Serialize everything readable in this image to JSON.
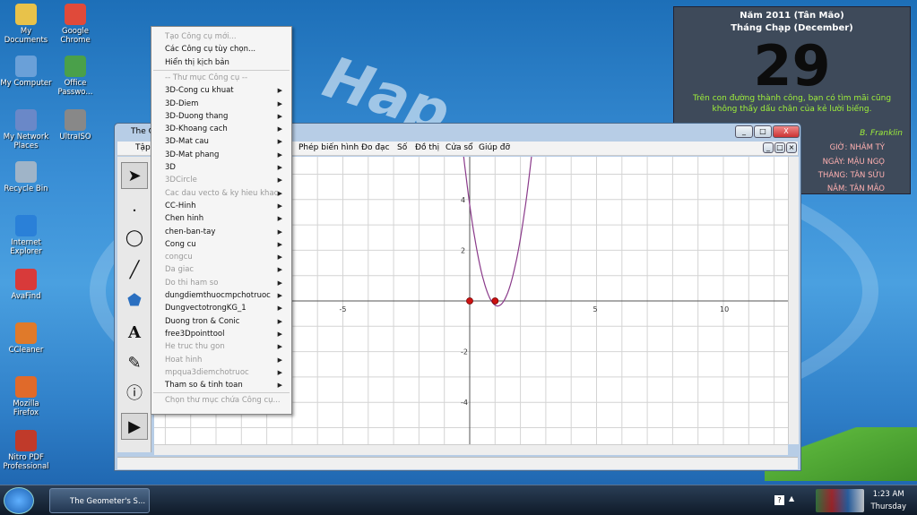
{
  "desktop": {
    "icons": [
      {
        "label": "My Documents"
      },
      {
        "label": "Google Chrome"
      },
      {
        "label": "My Computer"
      },
      {
        "label": "Office Passwo..."
      },
      {
        "label": "My Network Places"
      },
      {
        "label": "UltraISO"
      },
      {
        "label": "Recycle Bin"
      },
      {
        "label": "Internet Explorer"
      },
      {
        "label": "AvaFind"
      },
      {
        "label": "CCleaner"
      },
      {
        "label": "Mozilla Firefox"
      },
      {
        "label": "Nitro PDF Professional"
      }
    ]
  },
  "calendar": {
    "year_line": "Năm 2011 (Tân Mão)",
    "month_line": "Tháng Chạp (December)",
    "day": "29",
    "quote": "Trên con đường thành công, bạn có tìm mãi cũng không thấy dấu chân của kẻ lười biếng.",
    "author": "B. Franklin",
    "lunar": [
      "GIỜ: NHÂM TÝ",
      "NGÀY: MẬU NGỌ",
      "THÁNG: TÂN SỬU",
      "NĂM: TÂN MÃO"
    ]
  },
  "window": {
    "title": "The G",
    "menu": [
      "Tập",
      "Phép biến hình",
      "Đo đạc",
      "Số",
      "Đồ thị",
      "Cửa sổ",
      "Giúp đỡ"
    ],
    "controls": {
      "min": "_",
      "max": "□",
      "close": "X"
    }
  },
  "context_menu": {
    "items": [
      {
        "label": "Tạo Công cụ mới...",
        "disabled": true,
        "submenu": false
      },
      {
        "label": "Các Công cụ tùy chọn...",
        "disabled": false,
        "submenu": false
      },
      {
        "label": "Hiển thị kịch bản",
        "disabled": false,
        "submenu": false
      },
      {
        "label": "-- Thư mục Công cụ --",
        "disabled": true,
        "submenu": false
      },
      {
        "label": "3D-Cong cu khuat",
        "disabled": false,
        "submenu": true
      },
      {
        "label": "3D-Diem",
        "disabled": false,
        "submenu": true
      },
      {
        "label": "3D-Duong thang",
        "disabled": false,
        "submenu": true
      },
      {
        "label": "3D-Khoang cach",
        "disabled": false,
        "submenu": true
      },
      {
        "label": "3D-Mat cau",
        "disabled": false,
        "submenu": true
      },
      {
        "label": "3D-Mat phang",
        "disabled": false,
        "submenu": true
      },
      {
        "label": "3D",
        "disabled": false,
        "submenu": true
      },
      {
        "label": "3DCircle",
        "disabled": true,
        "submenu": true
      },
      {
        "label": "Cac dau vecto & ky hieu khac",
        "disabled": true,
        "submenu": true
      },
      {
        "label": "CC-Hinh",
        "disabled": false,
        "submenu": true
      },
      {
        "label": "Chen hinh",
        "disabled": false,
        "submenu": true
      },
      {
        "label": "chen-ban-tay",
        "disabled": false,
        "submenu": true
      },
      {
        "label": "Cong cu",
        "disabled": false,
        "submenu": true
      },
      {
        "label": "congcu",
        "disabled": true,
        "submenu": true
      },
      {
        "label": "Da giac",
        "disabled": true,
        "submenu": true
      },
      {
        "label": "Do thi ham so",
        "disabled": true,
        "submenu": true
      },
      {
        "label": "dungdiemthuocmpchotruoc",
        "disabled": false,
        "submenu": true
      },
      {
        "label": "DungvectotrongKG_1",
        "disabled": false,
        "submenu": true
      },
      {
        "label": "Duong tron & Conic",
        "disabled": false,
        "submenu": true
      },
      {
        "label": "free3Dpointtool",
        "disabled": false,
        "submenu": true
      },
      {
        "label": "He truc thu gon",
        "disabled": true,
        "submenu": true
      },
      {
        "label": "Hoat hinh",
        "disabled": true,
        "submenu": true
      },
      {
        "label": "mpqua3diemchotruoc",
        "disabled": true,
        "submenu": true
      },
      {
        "label": "Tham so & tinh toan",
        "disabled": false,
        "submenu": true
      },
      {
        "label": "Chọn thư mục chứa Công cụ...",
        "disabled": true,
        "submenu": false
      }
    ]
  },
  "graph": {
    "x_ticks": [
      "-5",
      "5",
      "10"
    ],
    "y_ticks": [
      "4",
      "2",
      "-2",
      "-4"
    ],
    "points": [
      {
        "x": 0,
        "y": 0
      },
      {
        "x": 1,
        "y": 0
      }
    ],
    "curve_color": "#8a3a8a",
    "point_color": "#cc1111"
  },
  "taskbar": {
    "task_label": "The Geometer's S...",
    "time": "1:23 AM",
    "day": "Thursday"
  }
}
